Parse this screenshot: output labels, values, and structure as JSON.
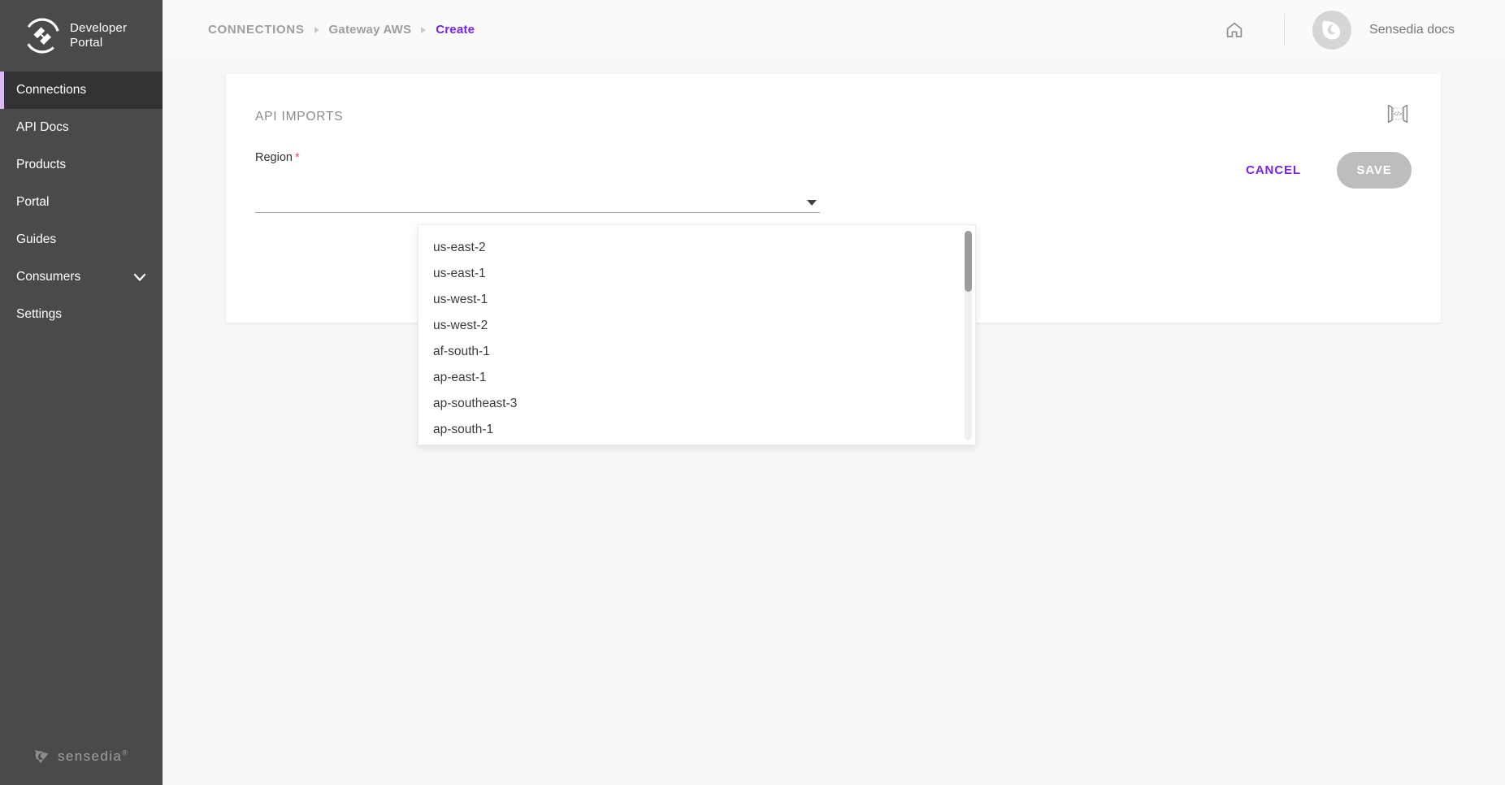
{
  "sidebar": {
    "logo": {
      "icon": "developer-portal-logo",
      "line1": "Developer",
      "line2": "Portal"
    },
    "items": [
      {
        "label": "Connections",
        "active": true,
        "chevron": false
      },
      {
        "label": "API Docs",
        "active": false,
        "chevron": false
      },
      {
        "label": "Products",
        "active": false,
        "chevron": false
      },
      {
        "label": "Portal",
        "active": false,
        "chevron": false
      },
      {
        "label": "Guides",
        "active": false,
        "chevron": false
      },
      {
        "label": "Consumers",
        "active": false,
        "chevron": true
      },
      {
        "label": "Settings",
        "active": false,
        "chevron": false
      }
    ],
    "footer": {
      "brand": "sensedia",
      "registered": "®",
      "icon": "sensedia-logo"
    }
  },
  "topbar": {
    "breadcrumb": [
      {
        "label": "CONNECTIONS",
        "current": false
      },
      {
        "label": "Gateway AWS",
        "current": false
      },
      {
        "label": "Create",
        "current": true
      }
    ],
    "home_icon": "home-icon",
    "user": {
      "name": "Sensedia docs",
      "avatar_icon": "user-avatar-sensedia"
    }
  },
  "card": {
    "title": "API IMPORTS",
    "head_icon": "api-code-import-icon",
    "field": {
      "label": "Region",
      "required_marker": "*",
      "value": "",
      "placeholder": "",
      "arrow_icon": "dropdown-arrow-icon"
    },
    "actions": {
      "cancel_label": "CANCEL",
      "save_label": "SAVE",
      "save_disabled": true
    }
  },
  "dropdown": {
    "open": true,
    "options": [
      "us-east-2",
      "us-east-1",
      "us-west-1",
      "us-west-2",
      "af-south-1",
      "ap-east-1",
      "ap-southeast-3",
      "ap-south-1"
    ],
    "scrollbar": {
      "icon": "vertical-scrollbar",
      "thumb_position": "top"
    }
  },
  "colors": {
    "accent_purple": "#7722ee",
    "sidebar_bg": "#4a4a4a",
    "sidebar_active_bg": "#333333",
    "sidebar_active_bar": "#d9b8f5",
    "page_bg": "#f7f7f7",
    "card_bg": "#ffffff",
    "required_red": "#e2445c",
    "disabled_gray": "#bdbdbd"
  }
}
